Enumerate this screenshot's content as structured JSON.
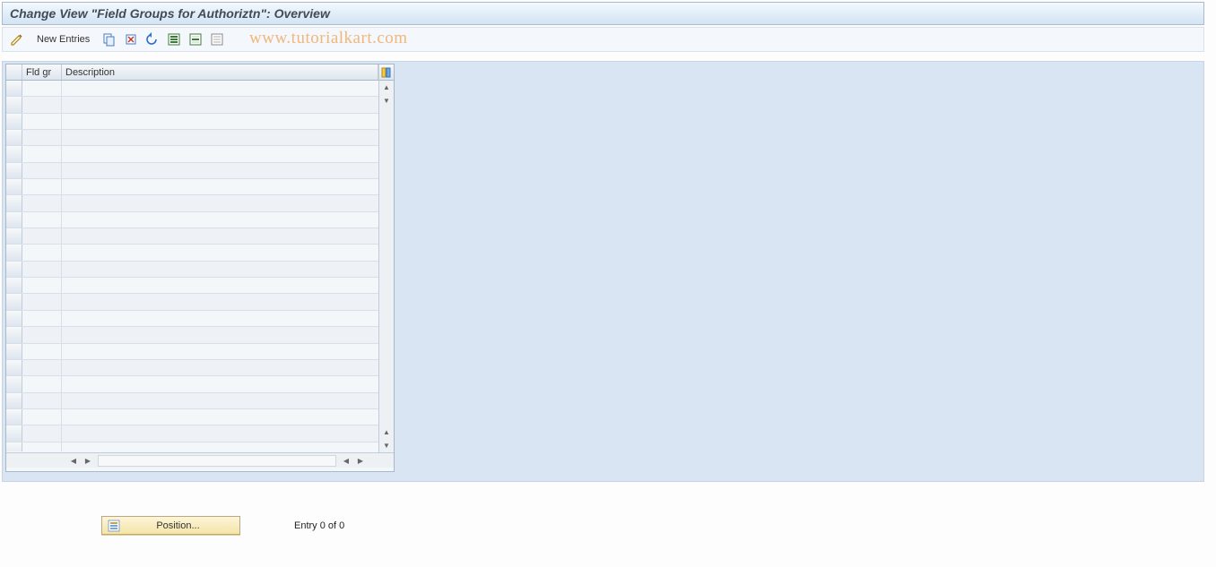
{
  "header": {
    "title": "Change View \"Field Groups for Authoriztn\": Overview"
  },
  "toolbar": {
    "new_entries_label": "New Entries"
  },
  "watermark": "www.tutorialkart.com",
  "table": {
    "columns": {
      "fld_gr": "Fld gr",
      "description": "Description"
    },
    "rows": []
  },
  "footer": {
    "position_label": "Position...",
    "entry_text": "Entry 0 of 0"
  }
}
